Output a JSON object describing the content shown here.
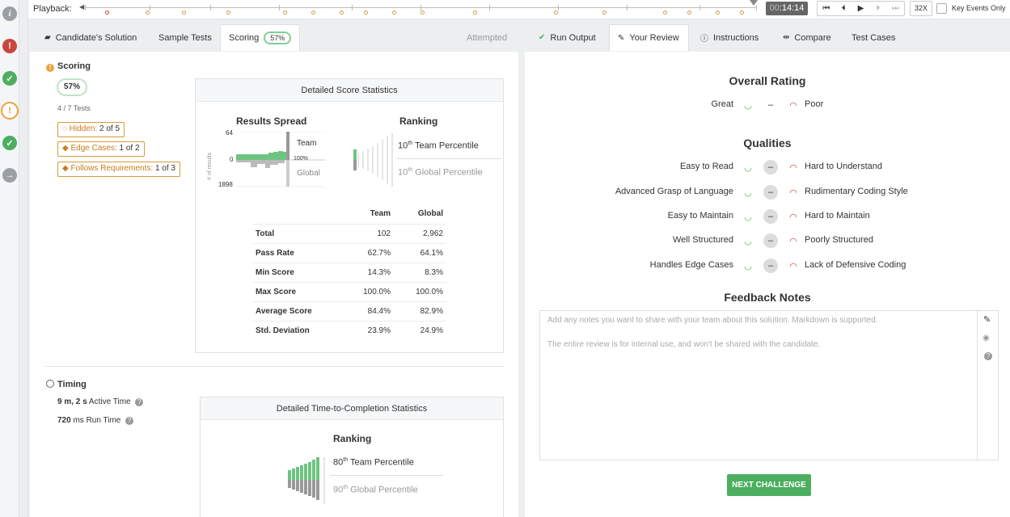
{
  "playback": {
    "label": "Playback:",
    "time_hours": "00",
    "time_rest": ":14:14",
    "speed": "32X",
    "key_events_label": "Key Events Only"
  },
  "tabs": {
    "solution": "Candidate's Solution",
    "sample_tests": "Sample Tests",
    "scoring": "Scoring",
    "scoring_pct": "57%",
    "attempted": "Attempted",
    "run_output": "Run Output",
    "your_review": "Your Review",
    "instructions": "Instructions",
    "compare": "Compare",
    "test_cases": "Test Cases"
  },
  "scoring": {
    "title": "Scoring",
    "percent": "57%",
    "tests": "4 / 7 Tests",
    "tags": [
      {
        "label": "Hidden:",
        "value": "2 of 5"
      },
      {
        "label": "Edge Cases:",
        "value": "1 of 2"
      },
      {
        "label": "Follows Requirements:",
        "value": "1 of 3"
      }
    ]
  },
  "score_stats": {
    "header": "Detailed Score Statistics",
    "spread_title": "Results Spread",
    "ranking_title": "Ranking",
    "y_top": "64",
    "y_mid": "0",
    "y_bottom": "1898",
    "y_axis_label": "# of results",
    "team_label": "Team",
    "global_label": "Global",
    "pct100": "100%",
    "team_percentile_num": "10",
    "team_percentile_sup": "th",
    "team_percentile_text": " Team Percentile",
    "global_percentile_num": "10",
    "global_percentile_sup": "th",
    "global_percentile_text": " Global Percentile",
    "columns": [
      "",
      "Team",
      "Global"
    ],
    "rows": [
      {
        "label": "Total",
        "team": "102",
        "global": "2,962"
      },
      {
        "label": "Pass Rate",
        "team": "62.7%",
        "global": "64.1%"
      },
      {
        "label": "Min Score",
        "team": "14.3%",
        "global": "8.3%"
      },
      {
        "label": "Max Score",
        "team": "100.0%",
        "global": "100.0%"
      },
      {
        "label": "Average Score",
        "team": "84.4%",
        "global": "82.9%"
      },
      {
        "label": "Std. Deviation",
        "team": "23.9%",
        "global": "24.9%"
      }
    ]
  },
  "timing": {
    "title": "Timing",
    "active_value": "9 m, 2 s",
    "active_label": " Active Time",
    "run_value": "720",
    "run_label": " ms Run Time",
    "header": "Detailed Time-to-Completion Statistics",
    "ranking_title": "Ranking",
    "team_percentile_num": "80",
    "team_percentile_sup": "th",
    "team_percentile_text": " Team Percentile",
    "global_percentile_num": "90",
    "global_percentile_sup": "th",
    "global_percentile_text": " Global Percentile"
  },
  "review": {
    "overall_title": "Overall Rating",
    "great": "Great",
    "poor": "Poor",
    "qualities_title": "Qualities",
    "qualities": [
      {
        "left": "Easy to Read",
        "right": "Hard to Understand"
      },
      {
        "left": "Advanced Grasp of Language",
        "right": "Rudimentary Coding Style"
      },
      {
        "left": "Easy to Maintain",
        "right": "Hard to Maintain"
      },
      {
        "left": "Well Structured",
        "right": "Poorly Structured"
      },
      {
        "left": "Handles Edge Cases",
        "right": "Lack of Defensive Coding"
      }
    ],
    "feedback_title": "Feedback Notes",
    "notes_line1": "Add any notes you want to share with your team about this solution. Markdown is supported.",
    "notes_line2": "The entire review is for internal use, and won't be shared with the candidate.",
    "next_button": "NEXT CHALLENGE"
  },
  "colors": {
    "accent_green": "#4cae5f",
    "warning_orange": "#e8a43a",
    "sad_red": "#c9473f"
  }
}
